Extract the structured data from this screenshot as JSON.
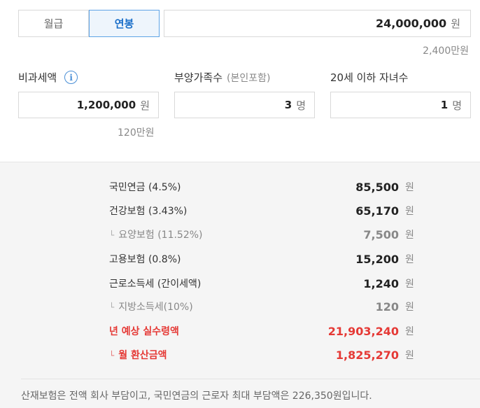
{
  "tabs": [
    {
      "label": "월급",
      "active": false
    },
    {
      "label": "연봉",
      "active": true
    }
  ],
  "salary": {
    "value": "24,000,000",
    "unit": "원",
    "hint": "2,400만원"
  },
  "fields": {
    "nontax": {
      "label": "비과세액",
      "value": "1,200,000",
      "unit": "원",
      "hint": "120만원"
    },
    "dependents": {
      "label": "부양가족수",
      "sublabel": "(본인포함)",
      "value": "3",
      "unit": "명"
    },
    "children": {
      "label": "20세 이하 자녀수",
      "value": "1",
      "unit": "명"
    }
  },
  "results": [
    {
      "label": "국민연금 (4.5%)",
      "value": "85,500",
      "unit": "원",
      "style": "normal"
    },
    {
      "label": "건강보험 (3.43%)",
      "value": "65,170",
      "unit": "원",
      "style": "normal"
    },
    {
      "label": "요양보험 (11.52%)",
      "value": "7,500",
      "unit": "원",
      "style": "sub"
    },
    {
      "label": "고용보험 (0.8%)",
      "value": "15,200",
      "unit": "원",
      "style": "normal"
    },
    {
      "label": "근로소득세 (간이세액)",
      "value": "1,240",
      "unit": "원",
      "style": "normal"
    },
    {
      "label": "지방소득세(10%)",
      "value": "120",
      "unit": "원",
      "style": "sub"
    },
    {
      "label": "년 예상 실수령액",
      "value": "21,903,240",
      "unit": "원",
      "style": "red"
    },
    {
      "label": "월 환산금액",
      "value": "1,825,270",
      "unit": "원",
      "style": "red-sub"
    }
  ],
  "footnote": "산재보험은 전액 회사 부담이고, 국민연금의 근로자 최대 부담액은 226,350원입니다.",
  "colors": {
    "accent": "#1a6fc9",
    "highlight": "#e53935"
  },
  "icons": {
    "info": "info-icon",
    "corner": "corner-arrow-icon"
  }
}
